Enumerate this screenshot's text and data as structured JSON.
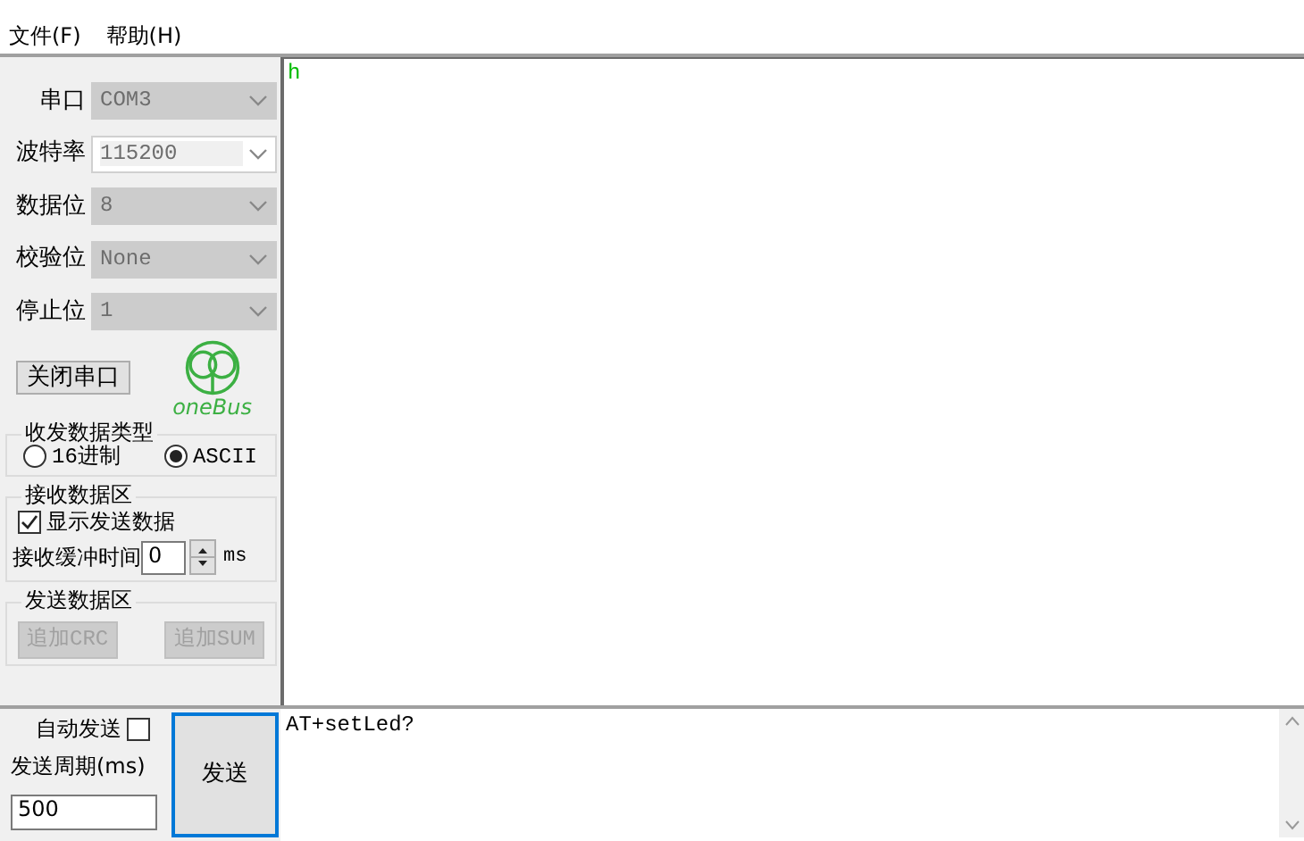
{
  "menu": [
    {
      "label": "文件(F)"
    },
    {
      "label": "帮助(H)"
    }
  ],
  "serial_settings": [
    {
      "label": "串口",
      "value": "COM3",
      "disabled": true
    },
    {
      "label": "波特率",
      "value": "115200",
      "disabled": false
    },
    {
      "label": "数据位",
      "value": "8",
      "disabled": true
    },
    {
      "label": "校验位",
      "value": "None",
      "disabled": true
    },
    {
      "label": "停止位",
      "value": "1",
      "disabled": true
    }
  ],
  "close_port_button": "关闭串口",
  "logo_text": "oneBus",
  "data_type": {
    "title": "收发数据类型",
    "options": [
      {
        "label": "16进制",
        "selected": false
      },
      {
        "label": "ASCII",
        "selected": true
      }
    ]
  },
  "receive_settings": {
    "title": "接收数据区",
    "show_sent": {
      "label": "显示发送数据",
      "checked": true
    },
    "buffer_label": "接收缓冲时间",
    "buffer_value": "0",
    "buffer_unit": "ms"
  },
  "send_settings": {
    "title": "发送数据区",
    "buttons": [
      {
        "label": "追加CRC",
        "disabled": true
      },
      {
        "label": "追加SUM",
        "disabled": true
      }
    ]
  },
  "receive_text": "h",
  "auto_send": {
    "label": "自动发送",
    "checked": false
  },
  "period": {
    "label": "发送周期(ms)",
    "value": "500"
  },
  "send_button": "发送",
  "send_text": "AT+setLed?"
}
